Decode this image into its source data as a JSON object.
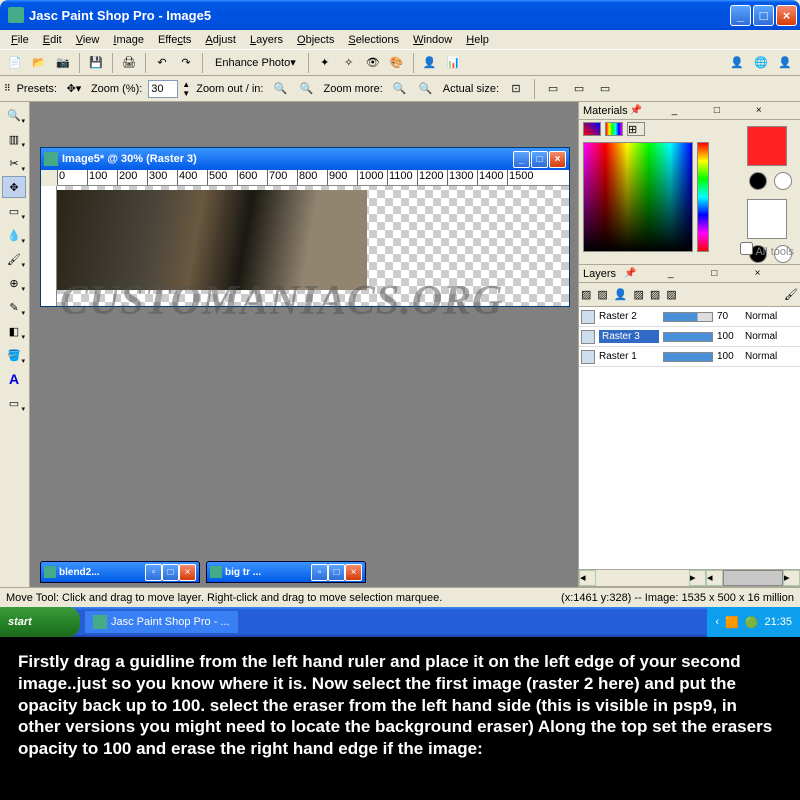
{
  "titlebar": {
    "title": "Jasc Paint Shop Pro - Image5"
  },
  "menu": {
    "file": "File",
    "edit": "Edit",
    "view": "View",
    "image": "Image",
    "effects": "Effects",
    "adjust": "Adjust",
    "layers": "Layers",
    "objects": "Objects",
    "selections": "Selections",
    "window": "Window",
    "help": "Help"
  },
  "toolbar": {
    "enhance": "Enhance Photo"
  },
  "zoomrow": {
    "presets": "Presets:",
    "zoom_pct": "Zoom (%):",
    "zoom_val": "30",
    "zoom_out": "Zoom out / in:",
    "zoom_more": "Zoom more:",
    "actual": "Actual size:"
  },
  "doc": {
    "title": "Image5* @   30%  (Raster 3)",
    "ruler": [
      "0",
      "100",
      "200",
      "300",
      "400",
      "500",
      "600",
      "700",
      "800",
      "900",
      "1000",
      "1100",
      "1200",
      "1300",
      "1400",
      "1500"
    ]
  },
  "mindocs": {
    "a": "blend2...",
    "b": "big tr ..."
  },
  "materials": {
    "title": "Materials",
    "alltools": "All tools"
  },
  "layers": {
    "title": "Layers",
    "rows": [
      {
        "name": "Raster 2",
        "opacity": "70",
        "mode": "Normal"
      },
      {
        "name": "Raster 3",
        "opacity": "100",
        "mode": "Normal"
      },
      {
        "name": "Raster 1",
        "opacity": "100",
        "mode": "Normal"
      }
    ]
  },
  "status": {
    "text": "Move Tool: Click and drag to move layer. Right-click and drag to move selection marquee.",
    "coords": "(x:1461 y:328) -- Image:   1535 x 500 x 16 million"
  },
  "taskbar": {
    "start": "start",
    "task": "Jasc Paint Shop Pro - ...",
    "time": "21:35"
  },
  "watermark": "CUSTOMANIACS.ORG",
  "tutorial": "Firstly drag a guidline from the left hand ruler and place it on the left edge of your second image..just so you know where it is. Now select the first image (raster 2 here) and put the opacity back up to 100. select the eraser from the left hand side (this is visible in psp9, in other versions you might need to locate the background eraser) Along the top set the erasers opacity to 100 and erase the right hand edge if the image:"
}
